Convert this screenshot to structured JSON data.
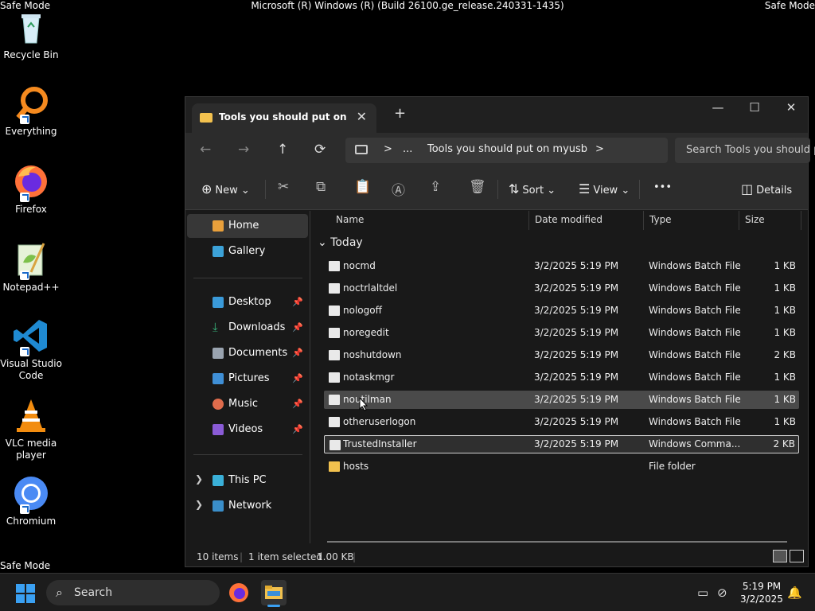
{
  "desktop": {
    "safe_mode_label": "Safe Mode",
    "build_text": "Microsoft (R) Windows (R) (Build 26100.ge_release.240331-1435)",
    "icons": [
      {
        "label": "Recycle Bin"
      },
      {
        "label": "Everything"
      },
      {
        "label": "Firefox"
      },
      {
        "label": "Notepad++"
      },
      {
        "label": "Visual Studio Code"
      },
      {
        "label": "VLC media player"
      },
      {
        "label": "Chromium"
      }
    ]
  },
  "explorer": {
    "tab_title": "Tools you should put on myusb",
    "window_controls": {
      "minimize": "—",
      "maximize": "☐",
      "close": "✕"
    },
    "nav": {
      "back": "←",
      "forward": "→",
      "up": "↑",
      "refresh": "⟳"
    },
    "address": {
      "more": "...",
      "path": "Tools you should put on myusb",
      "sep": ">"
    },
    "search_placeholder": "Search Tools you should p",
    "toolbar": {
      "new_label": "New",
      "sort_label": "Sort",
      "view_label": "View",
      "more": "•••",
      "details_label": "Details"
    },
    "sidebar": {
      "items": [
        {
          "label": "Home",
          "selected": true
        },
        {
          "label": "Gallery"
        },
        {
          "label": "Desktop",
          "pinned": true
        },
        {
          "label": "Downloads",
          "pinned": true
        },
        {
          "label": "Documents",
          "pinned": true
        },
        {
          "label": "Pictures",
          "pinned": true
        },
        {
          "label": "Music",
          "pinned": true
        },
        {
          "label": "Videos",
          "pinned": true
        },
        {
          "label": "This PC"
        },
        {
          "label": "Network"
        }
      ]
    },
    "columns": [
      "Name",
      "Date modified",
      "Type",
      "Size"
    ],
    "group_label": "Today",
    "files": [
      {
        "name": "nocmd",
        "date": "3/2/2025 5:19 PM",
        "type": "Windows Batch File",
        "size": "1 KB"
      },
      {
        "name": "noctrlaltdel",
        "date": "3/2/2025 5:19 PM",
        "type": "Windows Batch File",
        "size": "1 KB"
      },
      {
        "name": "nologoff",
        "date": "3/2/2025 5:19 PM",
        "type": "Windows Batch File",
        "size": "1 KB"
      },
      {
        "name": "noregedit",
        "date": "3/2/2025 5:19 PM",
        "type": "Windows Batch File",
        "size": "1 KB"
      },
      {
        "name": "noshutdown",
        "date": "3/2/2025 5:19 PM",
        "type": "Windows Batch File",
        "size": "2 KB"
      },
      {
        "name": "notaskmgr",
        "date": "3/2/2025 5:19 PM",
        "type": "Windows Batch File",
        "size": "1 KB"
      },
      {
        "name": "noutilman",
        "date": "3/2/2025 5:19 PM",
        "type": "Windows Batch File",
        "size": "1 KB"
      },
      {
        "name": "otheruserlogon",
        "date": "3/2/2025 5:19 PM",
        "type": "Windows Batch File",
        "size": "1 KB"
      },
      {
        "name": "TrustedInstaller",
        "date": "3/2/2025 5:19 PM",
        "type": "Windows Comma...",
        "size": "2 KB"
      },
      {
        "name": "hosts",
        "date": "",
        "type": "File folder",
        "size": ""
      }
    ],
    "status": {
      "items": "10 items",
      "selected": "1 item selected",
      "size": "1.00 KB"
    }
  },
  "taskbar": {
    "search_label": "Search",
    "time": "5:19 PM",
    "date": "3/2/2025"
  }
}
